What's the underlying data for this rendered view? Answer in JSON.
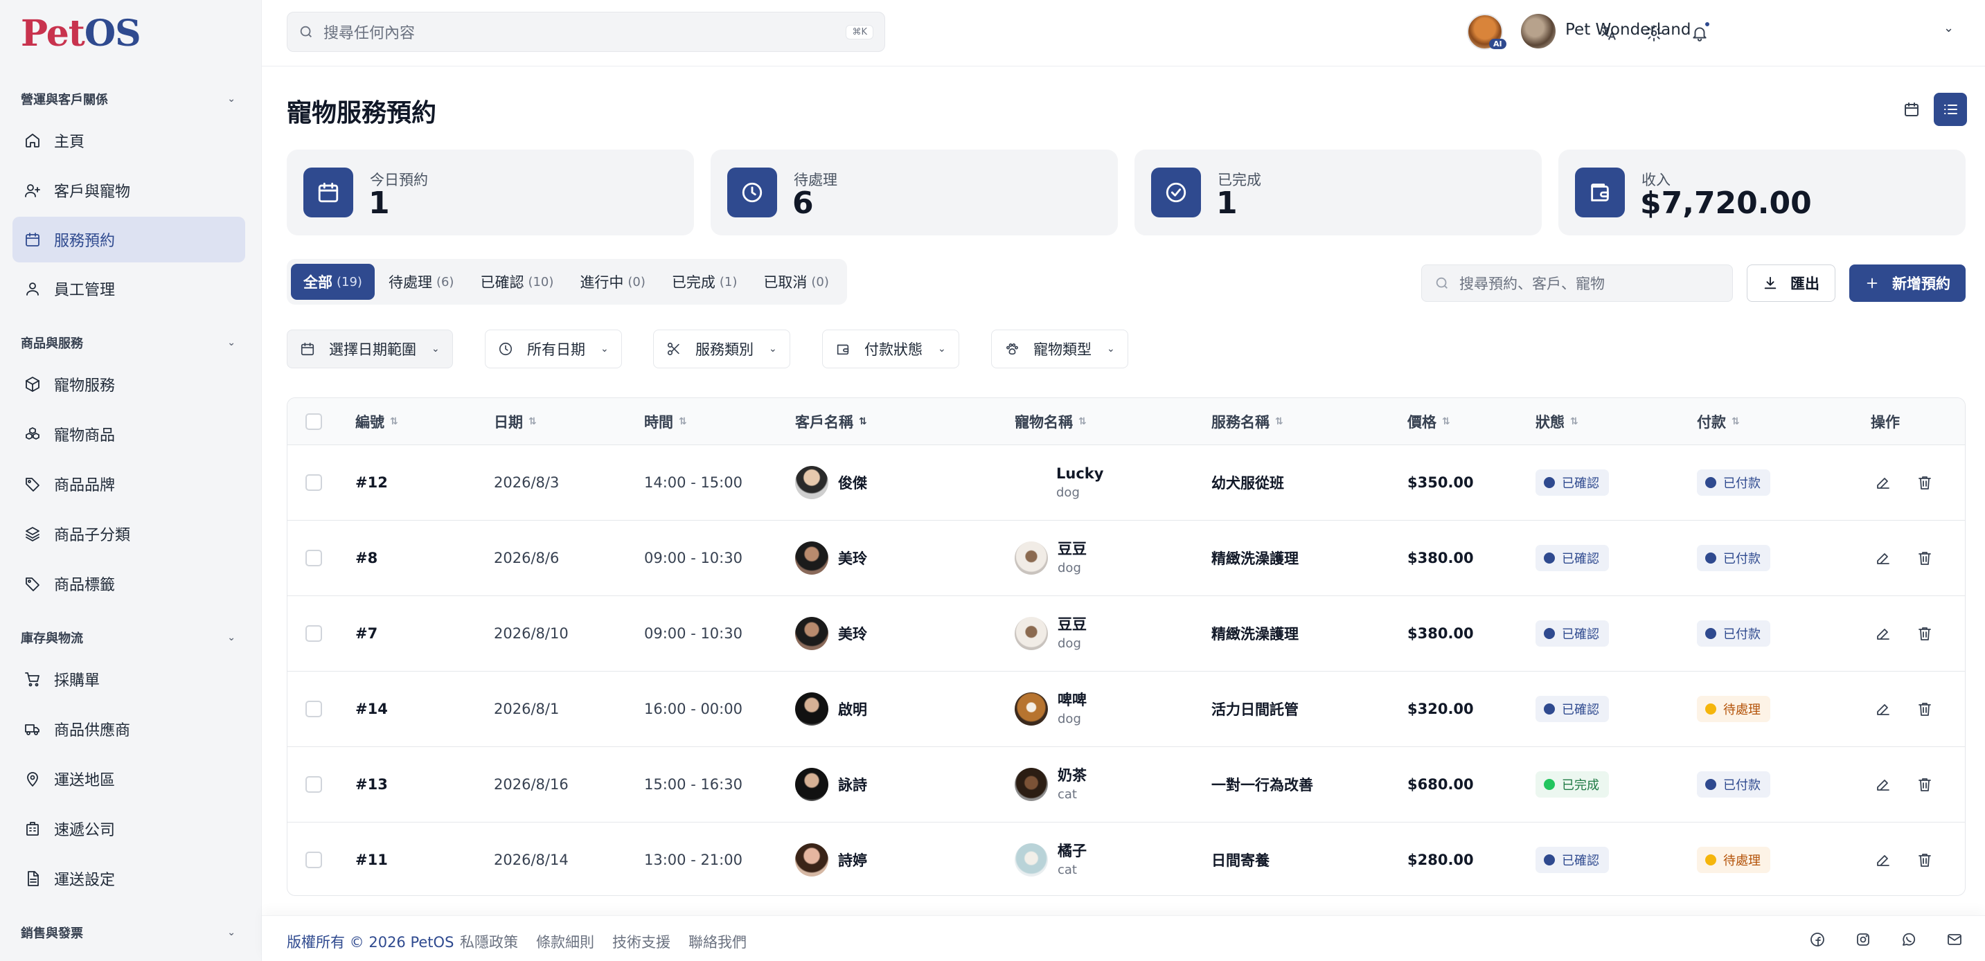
{
  "app": {
    "logo_main": "Pet",
    "logo_accent": "OS"
  },
  "sidebar": {
    "sections": [
      {
        "title": "營運與客戶關係"
      },
      {
        "title": "商品與服務"
      },
      {
        "title": "庫存與物流"
      },
      {
        "title": "銷售與發票"
      }
    ],
    "items": [
      {
        "label": "主頁",
        "icon": "home-icon"
      },
      {
        "label": "客戶與寵物",
        "icon": "user-plus-icon"
      },
      {
        "label": "服務預約",
        "icon": "calendar-icon",
        "active": true
      },
      {
        "label": "員工管理",
        "icon": "user-icon"
      },
      {
        "label": "寵物服務",
        "icon": "box-icon"
      },
      {
        "label": "寵物商品",
        "icon": "boxes-icon"
      },
      {
        "label": "商品品牌",
        "icon": "tag-icon"
      },
      {
        "label": "商品子分類",
        "icon": "layers-icon"
      },
      {
        "label": "商品標籤",
        "icon": "tag-icon"
      },
      {
        "label": "採購單",
        "icon": "cart-icon"
      },
      {
        "label": "商品供應商",
        "icon": "truck-icon"
      },
      {
        "label": "運送地區",
        "icon": "map-pin-icon"
      },
      {
        "label": "速遞公司",
        "icon": "building-icon"
      },
      {
        "label": "運送設定",
        "icon": "file-icon"
      }
    ]
  },
  "topbar": {
    "search_placeholder": "搜尋任何內容",
    "search_shortcut": "⌘K",
    "ai_badge": "AI",
    "user_name": "Pet Wonderland"
  },
  "page": {
    "title": "寵物服務預約"
  },
  "stats": [
    {
      "label": "今日預約",
      "value": "1",
      "icon": "calendar-icon"
    },
    {
      "label": "待處理",
      "value": "6",
      "icon": "clock-icon"
    },
    {
      "label": "已完成",
      "value": "1",
      "icon": "check-circle-icon"
    },
    {
      "label": "收入",
      "value": "$7,720.00",
      "icon": "wallet-icon"
    }
  ],
  "tabs": [
    {
      "label": "全部",
      "count": "(19)",
      "active": true
    },
    {
      "label": "待處理",
      "count": "(6)"
    },
    {
      "label": "已確認",
      "count": "(10)"
    },
    {
      "label": "進行中",
      "count": "(0)"
    },
    {
      "label": "已完成",
      "count": "(1)"
    },
    {
      "label": "已取消",
      "count": "(0)"
    }
  ],
  "toolbar": {
    "search_placeholder": "搜尋預約、客戶、寵物",
    "export_label": "匯出",
    "new_label": "新增預約"
  },
  "filters": [
    {
      "label": "選擇日期範圍",
      "icon": "calendar-icon"
    },
    {
      "label": "所有日期",
      "icon": "clock-icon"
    },
    {
      "label": "服務類別",
      "icon": "scissors-icon"
    },
    {
      "label": "付款狀態",
      "icon": "wallet-icon"
    },
    {
      "label": "寵物類型",
      "icon": "paw-icon"
    }
  ],
  "table": {
    "columns": [
      "編號",
      "日期",
      "時間",
      "客戶名稱",
      "寵物名稱",
      "服務名稱",
      "價格",
      "狀態",
      "付款",
      "操作"
    ],
    "rows": [
      {
        "id": "#12",
        "date": "2026/8/3",
        "time": "14:00 - 15:00",
        "customer": "俊傑",
        "pet": "Lucky",
        "pet_type": "dog",
        "service": "幼犬服從班",
        "price": "$350.00",
        "status": "已確認",
        "status_color": "#2f4a8f",
        "payment": "已付款",
        "payment_color": "#2f4a8f"
      },
      {
        "id": "#8",
        "date": "2026/8/6",
        "time": "09:00 - 10:30",
        "customer": "美玲",
        "pet": "豆豆",
        "pet_type": "dog",
        "service": "精緻洗澡護理",
        "price": "$380.00",
        "status": "已確認",
        "status_color": "#2f4a8f",
        "payment": "已付款",
        "payment_color": "#2f4a8f"
      },
      {
        "id": "#7",
        "date": "2026/8/10",
        "time": "09:00 - 10:30",
        "customer": "美玲",
        "pet": "豆豆",
        "pet_type": "dog",
        "service": "精緻洗澡護理",
        "price": "$380.00",
        "status": "已確認",
        "status_color": "#2f4a8f",
        "payment": "已付款",
        "payment_color": "#2f4a8f"
      },
      {
        "id": "#14",
        "date": "2026/8/1",
        "time": "16:00 - 00:00",
        "customer": "啟明",
        "pet": "啤啤",
        "pet_type": "dog",
        "service": "活力日間託管",
        "price": "$320.00",
        "status": "已確認",
        "status_color": "#2f4a8f",
        "payment": "待處理",
        "payment_color": "#f5b50b"
      },
      {
        "id": "#13",
        "date": "2026/8/16",
        "time": "15:00 - 16:30",
        "customer": "詠詩",
        "pet": "奶茶",
        "pet_type": "cat",
        "service": "一對一行為改善",
        "price": "$680.00",
        "status": "已完成",
        "status_color": "#22c55e",
        "payment": "已付款",
        "payment_color": "#2f4a8f"
      },
      {
        "id": "#11",
        "date": "2026/8/14",
        "time": "13:00 - 21:00",
        "customer": "詩婷",
        "pet": "橘子",
        "pet_type": "cat",
        "service": "日間寄養",
        "price": "$280.00",
        "status": "已確認",
        "status_color": "#2f4a8f",
        "payment": "待處理",
        "payment_color": "#f5b50b"
      }
    ]
  },
  "footer": {
    "copyright": "版權所有 © 2026 PetOS",
    "links": [
      "私隱政策",
      "條款細則",
      "技術支援",
      "聯絡我們"
    ],
    "social": [
      "facebook-icon",
      "instagram-icon",
      "whatsapp-icon",
      "mail-icon"
    ]
  }
}
